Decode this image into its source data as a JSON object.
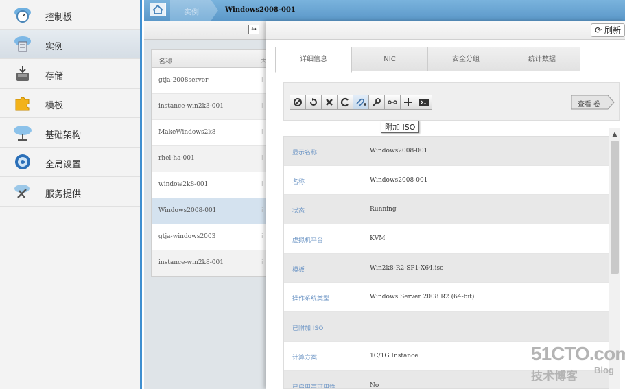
{
  "sidebar": {
    "items": [
      {
        "label": "控制板",
        "icon": "dashboard-icon"
      },
      {
        "label": "实例",
        "icon": "instances-icon"
      },
      {
        "label": "存储",
        "icon": "storage-icon"
      },
      {
        "label": "模板",
        "icon": "template-icon"
      },
      {
        "label": "基础架构",
        "icon": "infrastructure-icon"
      },
      {
        "label": "全局设置",
        "icon": "global-settings-icon"
      },
      {
        "label": "服务提供",
        "icon": "service-offerings-icon"
      }
    ]
  },
  "breadcrumb": {
    "middle": "实例",
    "current": "Windows2008-001"
  },
  "list": {
    "header": {
      "name": "名称",
      "ext": "内"
    },
    "rows": [
      {
        "name": "gtja-2008server",
        "ext": "i"
      },
      {
        "name": "instance-win2k3-001",
        "ext": "i"
      },
      {
        "name": "MakeWindows2k8",
        "ext": "i"
      },
      {
        "name": "rhel-ha-001",
        "ext": "i"
      },
      {
        "name": "window2k8-001",
        "ext": "i"
      },
      {
        "name": "Windows2008-001",
        "ext": "i"
      },
      {
        "name": "gtja-windows2003",
        "ext": "i"
      },
      {
        "name": "instance-win2k8-001",
        "ext": "i"
      }
    ]
  },
  "detail": {
    "refresh_label": "刷新",
    "tabs": [
      "详细信息",
      "NIC",
      "安全分组",
      "统计数据"
    ],
    "view_volumes_label": "查看 卷",
    "tooltip": "附加 ISO",
    "properties": [
      {
        "key": "显示名称",
        "value": "Windows2008-001"
      },
      {
        "key": "名称",
        "value": "Windows2008-001"
      },
      {
        "key": "状态",
        "value": "Running"
      },
      {
        "key": "虚拟机平台",
        "value": "KVM"
      },
      {
        "key": "模板",
        "value": "Win2k8-R2-SP1-X64.iso"
      },
      {
        "key": "操作系统类型",
        "value": "Windows Server 2008 R2 (64-bit)"
      },
      {
        "key": "已附加 ISO",
        "value": ""
      },
      {
        "key": "计算方案",
        "value": "1C/1G Instance"
      },
      {
        "key": "已启用高可用性",
        "value": "No"
      }
    ]
  },
  "watermark": {
    "main": "51CTO.com",
    "sub": "技术博客",
    "blog": "Blog"
  },
  "colors": {
    "accent": "#3f8fd0",
    "topbar": "#5b98c9",
    "selected_row": "#d4e2ef",
    "prop_key": "#6f97c6"
  }
}
